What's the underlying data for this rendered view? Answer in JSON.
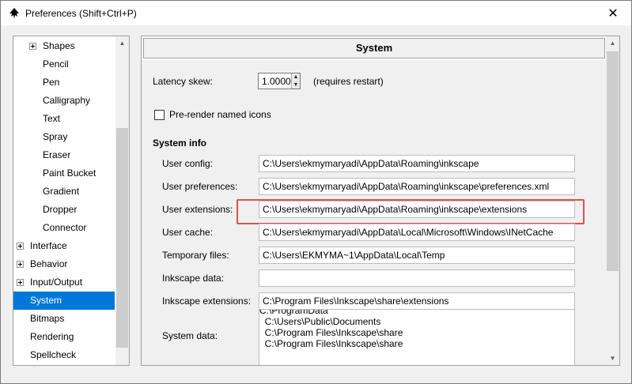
{
  "window": {
    "title": "Preferences (Shift+Ctrl+P)"
  },
  "tree": {
    "items": [
      {
        "label": "Shapes",
        "indent": 1,
        "expander": true,
        "selected": false
      },
      {
        "label": "Pencil",
        "indent": 2,
        "expander": false,
        "selected": false
      },
      {
        "label": "Pen",
        "indent": 2,
        "expander": false,
        "selected": false
      },
      {
        "label": "Calligraphy",
        "indent": 2,
        "expander": false,
        "selected": false
      },
      {
        "label": "Text",
        "indent": 2,
        "expander": false,
        "selected": false
      },
      {
        "label": "Spray",
        "indent": 2,
        "expander": false,
        "selected": false
      },
      {
        "label": "Eraser",
        "indent": 2,
        "expander": false,
        "selected": false
      },
      {
        "label": "Paint Bucket",
        "indent": 2,
        "expander": false,
        "selected": false
      },
      {
        "label": "Gradient",
        "indent": 2,
        "expander": false,
        "selected": false
      },
      {
        "label": "Dropper",
        "indent": 2,
        "expander": false,
        "selected": false
      },
      {
        "label": "Connector",
        "indent": 2,
        "expander": false,
        "selected": false
      },
      {
        "label": "Interface",
        "indent": 0,
        "expander": true,
        "selected": false
      },
      {
        "label": "Behavior",
        "indent": 0,
        "expander": true,
        "selected": false
      },
      {
        "label": "Input/Output",
        "indent": 0,
        "expander": true,
        "selected": false
      },
      {
        "label": "System",
        "indent": 0,
        "expander": false,
        "selected": true
      },
      {
        "label": "Bitmaps",
        "indent": 0,
        "expander": false,
        "selected": false
      },
      {
        "label": "Rendering",
        "indent": 0,
        "expander": false,
        "selected": false
      },
      {
        "label": "Spellcheck",
        "indent": 0,
        "expander": false,
        "selected": false
      }
    ]
  },
  "panel": {
    "header": "System",
    "latency": {
      "label": "Latency skew:",
      "value": "1.0000",
      "note": "(requires restart)"
    },
    "prerender": {
      "label": "Pre-render named icons",
      "checked": false
    },
    "system_info_heading": "System info",
    "fields": [
      {
        "label": "User config:",
        "value": "C:\\Users\\ekmymaryadi\\AppData\\Roaming\\inkscape"
      },
      {
        "label": "User preferences:",
        "value": "C:\\Users\\ekmymaryadi\\AppData\\Roaming\\inkscape\\preferences.xml"
      },
      {
        "label": "User extensions:",
        "value": "C:\\Users\\ekmymaryadi\\AppData\\Roaming\\inkscape\\extensions"
      },
      {
        "label": "User cache:",
        "value": "C:\\Users\\ekmymaryadi\\AppData\\Local\\Microsoft\\Windows\\INetCache"
      },
      {
        "label": "Temporary files:",
        "value": "C:\\Users\\EKMYMA~1\\AppData\\Local\\Temp"
      },
      {
        "label": "Inkscape data:",
        "value": ""
      },
      {
        "label": "Inkscape extensions:",
        "value": "C:\\Program Files\\Inkscape\\share\\extensions"
      }
    ],
    "system_data": {
      "label": "System data:",
      "lines": [
        "C:\\ProgramData",
        "  C:\\Users\\Public\\Documents",
        "  C:\\Program Files\\Inkscape\\share",
        "  C:\\Program Files\\Inkscape\\share"
      ]
    }
  },
  "colors": {
    "selection": "#0078d7",
    "highlight": "#d9534f"
  },
  "icons": {
    "app": "inkscape-icon",
    "close": "close-icon",
    "expander": "plus-box-icon"
  }
}
